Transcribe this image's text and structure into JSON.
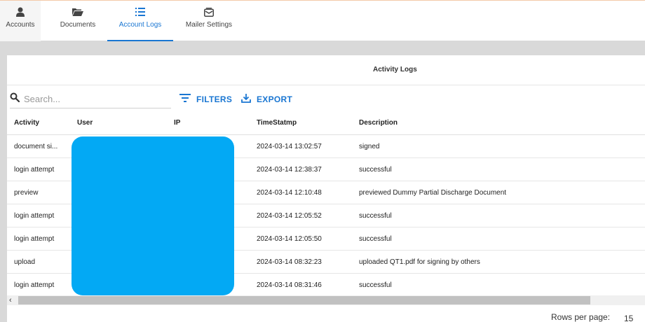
{
  "nav": {
    "tabs": [
      {
        "label": "Accounts",
        "icon": "person-icon"
      },
      {
        "label": "Documents",
        "icon": "folder-open-icon"
      },
      {
        "label": "Account Logs",
        "icon": "list-icon"
      },
      {
        "label": "Mailer Settings",
        "icon": "mail-settings-icon"
      }
    ],
    "active_color": "#1976d2"
  },
  "panel": {
    "title": "Activity Logs",
    "search_placeholder": "Search...",
    "filters_label": "FILTERS",
    "export_label": "EXPORT"
  },
  "table": {
    "headers": {
      "activity": "Activity",
      "user": "User",
      "ip": "IP",
      "timestamp": "TimeStatmp",
      "description": "Description"
    },
    "rows": [
      {
        "activity": "document si...",
        "timestamp": "2024-03-14 13:02:57",
        "description": "signed"
      },
      {
        "activity": "login attempt",
        "timestamp": "2024-03-14 12:38:37",
        "description": "successful"
      },
      {
        "activity": "preview",
        "timestamp": "2024-03-14 12:10:48",
        "description": "previewed Dummy Partial Discharge Document"
      },
      {
        "activity": "login attempt",
        "timestamp": "2024-03-14 12:05:52",
        "description": "successful"
      },
      {
        "activity": "login attempt",
        "timestamp": "2024-03-14 12:05:50",
        "description": "successful"
      },
      {
        "activity": "upload",
        "timestamp": "2024-03-14 08:32:23",
        "description": "uploaded QT1.pdf for signing by others"
      },
      {
        "activity": "login attempt",
        "timestamp": "2024-03-14 08:31:46",
        "description": "successful"
      }
    ],
    "redaction_color": "#03a9f4"
  },
  "footer": {
    "rows_per_page_label": "Rows per page:",
    "rows_per_page_value": "15"
  }
}
